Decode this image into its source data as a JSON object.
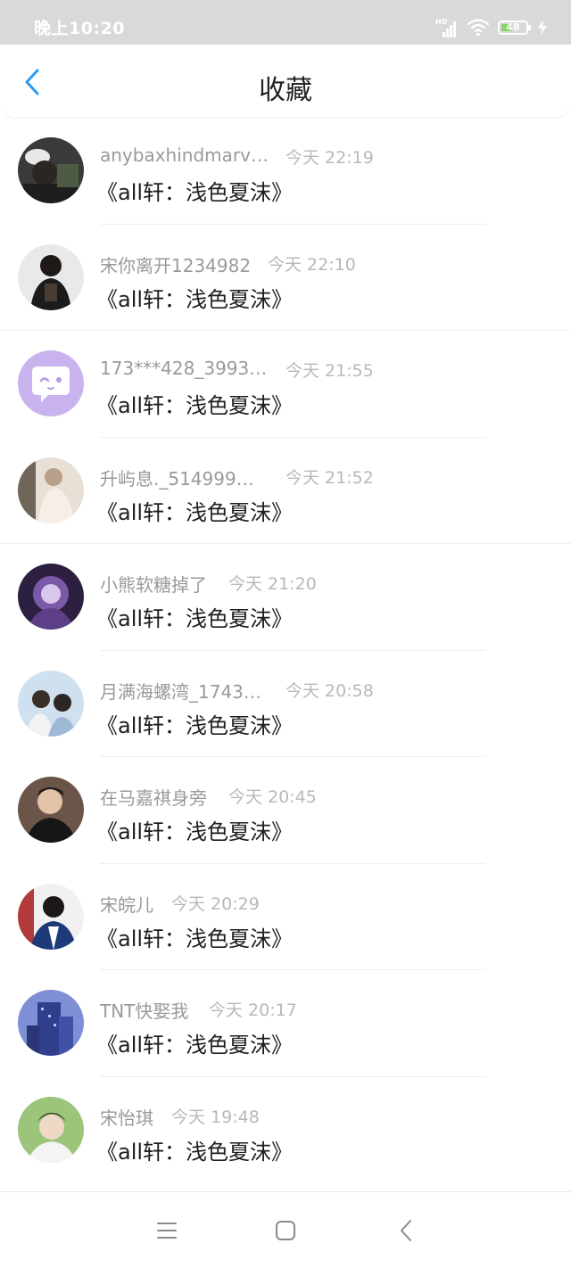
{
  "status_bar": {
    "time": "晚上10:20",
    "network_label": "HD",
    "battery_level": "48",
    "battery_fraction": 0.48,
    "icons": [
      "signal-icon",
      "wifi-icon",
      "battery-icon",
      "charging-icon"
    ]
  },
  "header": {
    "title": "收藏",
    "back_icon": "chevron-left-icon",
    "accent_color": "#2f9bf0"
  },
  "favorites": [
    {
      "user": "anybaxhindmarv…",
      "time": "今天 22:19",
      "book": "《all轩：浅色夏沫》",
      "avatar": "photo"
    },
    {
      "user": "宋你离开1234982",
      "time": "今天 22:10",
      "book": "《all轩：浅色夏沫》",
      "avatar": "photo"
    },
    {
      "user": "173***428_3993…",
      "time": "今天 21:55",
      "book": "《all轩：浅色夏沫》",
      "avatar": "default-chat-avatar"
    },
    {
      "user": "升屿息._514999…",
      "time": "今天 21:52",
      "book": "《all轩：浅色夏沫》",
      "avatar": "photo"
    },
    {
      "user": "小熊软糖掉了",
      "time": "今天 21:20",
      "book": "《all轩：浅色夏沫》",
      "avatar": "photo"
    },
    {
      "user": "月满海螺湾_1743…",
      "time": "今天 20:58",
      "book": "《all轩：浅色夏沫》",
      "avatar": "photo"
    },
    {
      "user": "在马嘉祺身旁",
      "time": "今天 20:45",
      "book": "《all轩：浅色夏沫》",
      "avatar": "photo"
    },
    {
      "user": "宋皖儿",
      "time": "今天 20:29",
      "book": "《all轩：浅色夏沫》",
      "avatar": "photo"
    },
    {
      "user": "TNT快娶我",
      "time": "今天 20:17",
      "book": "《all轩：浅色夏沫》",
      "avatar": "photo"
    },
    {
      "user": "宋怡琪",
      "time": "今天 19:48",
      "book": "《all轩：浅色夏沫》",
      "avatar": "photo"
    }
  ],
  "nav_bar": {
    "icons": [
      "menu-icon",
      "home-icon",
      "back-icon"
    ]
  }
}
